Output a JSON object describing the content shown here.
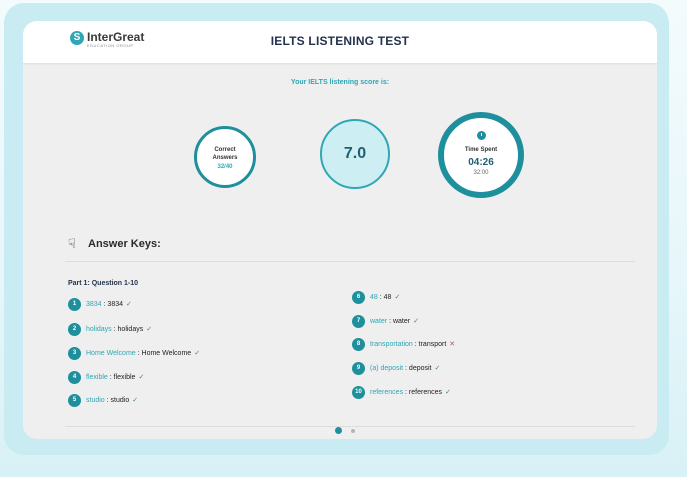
{
  "header": {
    "logo_name": "InterGreat",
    "logo_sub": "EDUCATION GROUP",
    "title": "IELTS LISTENING TEST"
  },
  "score": {
    "label": "Your IELTS listening score is:",
    "correct_label_1": "Correct",
    "correct_label_2": "Answers",
    "correct_value": "32/40",
    "band": "7.0",
    "time_label": "Time Spent",
    "time_value": "04:26",
    "time_total": "32:00"
  },
  "answer_keys": {
    "title": "Answer Keys:",
    "part_title": "Part 1: Question 1-10",
    "items": [
      {
        "num": "1",
        "answer": "3834",
        "key": "3834",
        "mark": "✓"
      },
      {
        "num": "2",
        "answer": "holidays",
        "key": "holidays",
        "mark": "✓"
      },
      {
        "num": "3",
        "answer": "Home Welcome",
        "key": "Home Welcome",
        "mark": "✓"
      },
      {
        "num": "4",
        "answer": "flexible",
        "key": "flexible",
        "mark": "✓"
      },
      {
        "num": "5",
        "answer": "studio",
        "key": "studio",
        "mark": "✓"
      },
      {
        "num": "6",
        "answer": "48",
        "key": "48",
        "mark": "✓"
      },
      {
        "num": "7",
        "answer": "water",
        "key": "water",
        "mark": "✓"
      },
      {
        "num": "8",
        "answer": "transportation",
        "key": "transport",
        "mark": "✕"
      },
      {
        "num": "9",
        "answer": "(a) deposit",
        "key": "deposit",
        "mark": "✓"
      },
      {
        "num": "10",
        "answer": "references",
        "key": "references",
        "mark": "✓"
      }
    ]
  },
  "colors": {
    "accent": "#1e8f9c",
    "accent_light": "#2fa7b4",
    "correct": "#3e8f54",
    "wrong": "#d24a4a"
  }
}
